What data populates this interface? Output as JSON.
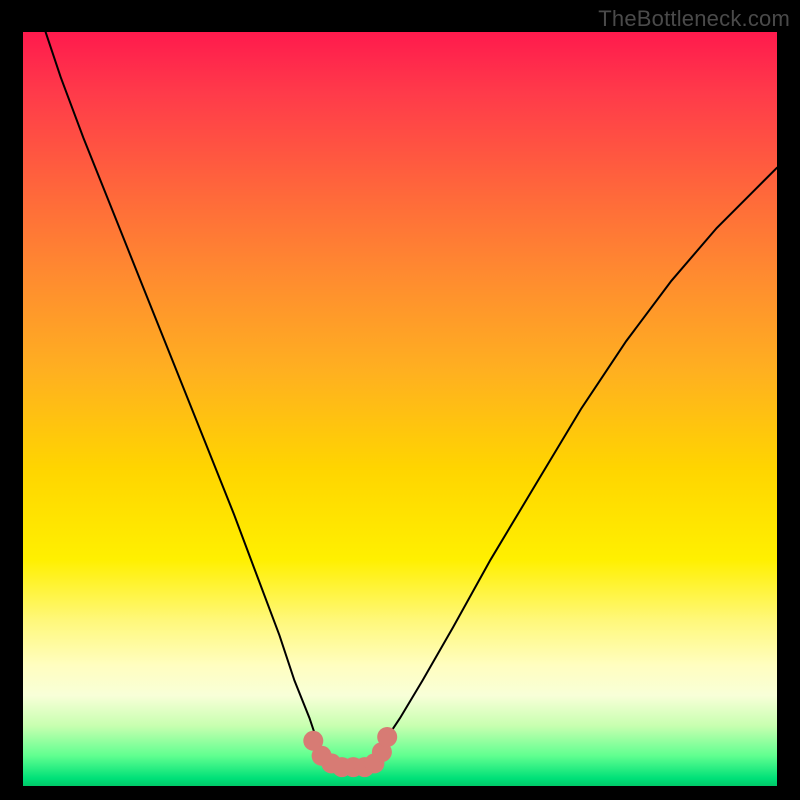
{
  "watermark": "TheBottleneck.com",
  "chart_data": {
    "type": "line",
    "title": "",
    "xlabel": "",
    "ylabel": "",
    "xlim": [
      0,
      100
    ],
    "ylim": [
      0,
      100
    ],
    "series": [
      {
        "name": "curve",
        "color": "#000000",
        "width": 2,
        "x": [
          3,
          5,
          8,
          12,
          16,
          20,
          24,
          28,
          31,
          34,
          36,
          38,
          39,
          40,
          41,
          42,
          43,
          44,
          45,
          46,
          47,
          48,
          50,
          53,
          57,
          62,
          68,
          74,
          80,
          86,
          92,
          97,
          100
        ],
        "y": [
          100,
          94,
          86,
          76,
          66,
          56,
          46,
          36,
          28,
          20,
          14,
          9,
          6,
          4,
          3,
          2.5,
          2.5,
          2.5,
          2.5,
          3,
          4,
          6,
          9,
          14,
          21,
          30,
          40,
          50,
          59,
          67,
          74,
          79,
          82
        ]
      },
      {
        "name": "marker-band",
        "type": "scatter",
        "color": "#d77b74",
        "radius": 10,
        "x": [
          38.5,
          39.6,
          40.9,
          42.3,
          43.8,
          45.3,
          46.6,
          47.6,
          48.3
        ],
        "y": [
          6.0,
          4.0,
          3.0,
          2.5,
          2.5,
          2.5,
          3.0,
          4.5,
          6.5
        ]
      }
    ]
  }
}
